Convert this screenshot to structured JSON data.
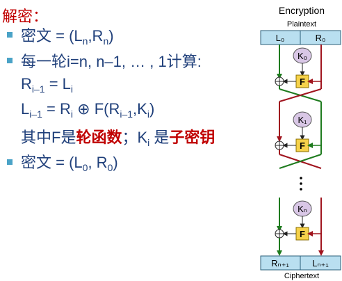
{
  "text": {
    "title": "解密：",
    "bullet1": {
      "prefix": "密文 = (L",
      "sub1": "n",
      "mid": ",R",
      "sub2": "n",
      "suffix": ")"
    },
    "bullet2": "每一轮i=n, n–1, … , 1计算:",
    "eq1": {
      "a": "R",
      "a_sub": "i–1",
      "mid": " = L",
      "b_sub": "i"
    },
    "eq2": {
      "a": "L",
      "a_sub": "i–1",
      "b": " = R",
      "b_sub": "i",
      "c": " ⊕ F(R",
      "c_sub": "i–1",
      "d": ",K",
      "d_sub": "i",
      "e": ")"
    },
    "line5": {
      "a": "其中F是",
      "b": "轮函数",
      "c": "；K",
      "c_sub": "i",
      "d": " 是",
      "e": "子密钥"
    },
    "bullet3": {
      "prefix": "密文 = (L",
      "sub1": "0",
      "mid": ", R",
      "sub2": "0",
      "suffix": ")"
    }
  },
  "diagram": {
    "title": "Encryption",
    "top_label": "Plaintext",
    "top_left": "L₀",
    "top_right": "R₀",
    "key0": "K₀",
    "key1": "K₁",
    "keyn": "Kₙ",
    "f_label": "F",
    "bottom_left": "Rₙ₊₁",
    "bottom_right": "Lₙ₊₁",
    "bottom_label": "Ciphertext"
  },
  "colors": {
    "title_red": "#c00000",
    "text_blue": "#1f3f7a",
    "bullet": "#4aa3c7",
    "box_fill": "#b9dff0",
    "f_fill": "#f6d24a",
    "key_fill": "#d9c7e6",
    "green": "#1e7b1e",
    "darkred": "#a0141e"
  }
}
